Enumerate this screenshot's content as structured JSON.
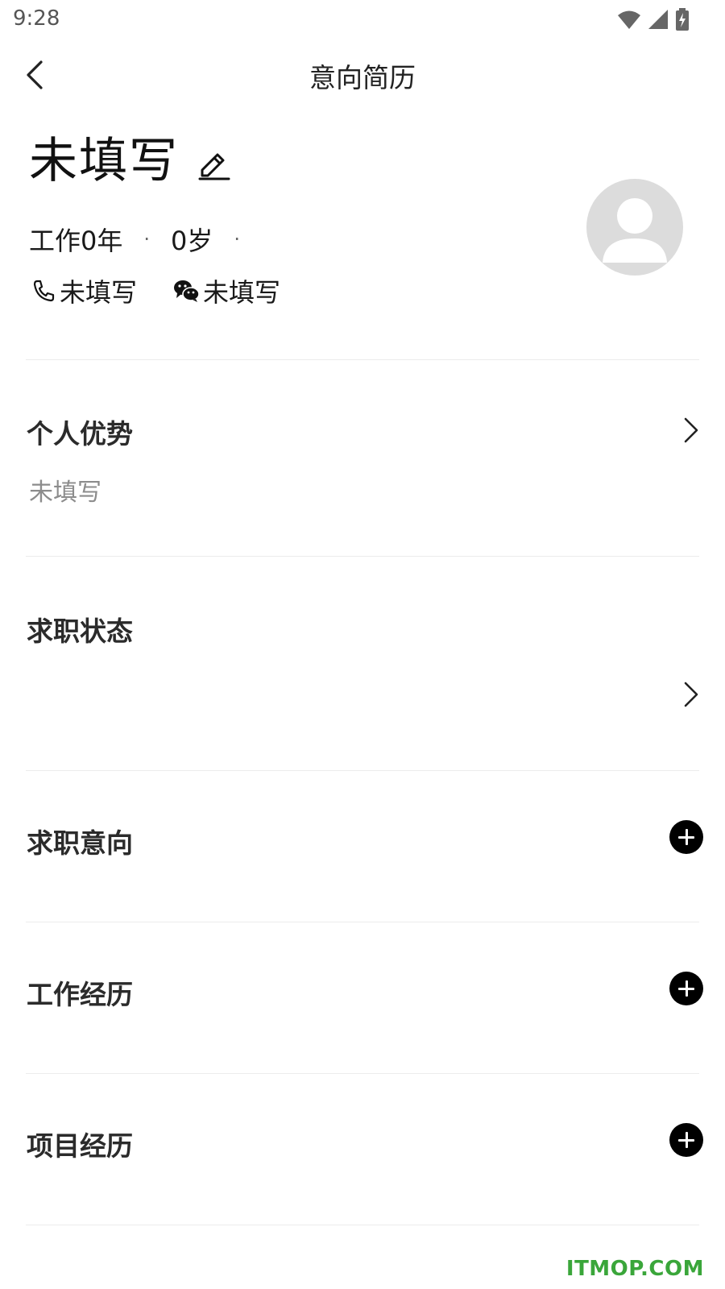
{
  "status_bar": {
    "time": "9:28"
  },
  "nav": {
    "title": "意向简历"
  },
  "profile": {
    "name": "未填写",
    "experience": "工作0年",
    "age": "0岁",
    "separator": "·",
    "phone": "未填写",
    "wechat": "未填写"
  },
  "sections": {
    "advantage": {
      "title": "个人优势",
      "value": "未填写"
    },
    "job_status": {
      "title": "求职状态"
    },
    "job_intention": {
      "title": "求职意向"
    },
    "work_experience": {
      "title": "工作经历"
    },
    "project_experience": {
      "title": "项目经历"
    }
  },
  "watermark": "ITMOP.COM"
}
